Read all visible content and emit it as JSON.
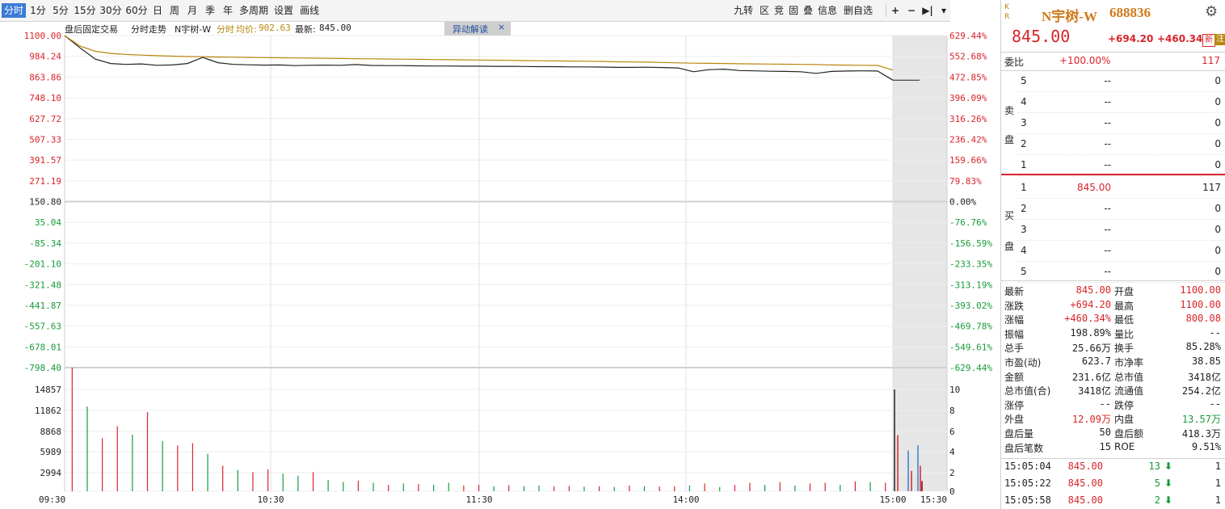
{
  "toolbar": {
    "left": [
      {
        "id": "fenshi",
        "label": "分时",
        "active": true
      },
      {
        "id": "1min",
        "label": "1分"
      },
      {
        "id": "5min",
        "label": "5分"
      },
      {
        "id": "15min",
        "label": "15分"
      },
      {
        "id": "30min",
        "label": "30分"
      },
      {
        "id": "60min",
        "label": "60分"
      },
      {
        "id": "day",
        "label": "日"
      },
      {
        "id": "week",
        "label": "周"
      },
      {
        "id": "month",
        "label": "月"
      },
      {
        "id": "season",
        "label": "季"
      },
      {
        "id": "year",
        "label": "年"
      },
      {
        "id": "multi",
        "label": "多周期"
      },
      {
        "id": "settings",
        "label": "设置"
      },
      {
        "id": "draw",
        "label": "画线"
      }
    ],
    "right": [
      {
        "id": "jiuzhuan",
        "label": "九转"
      },
      {
        "id": "qu",
        "label": "区"
      },
      {
        "id": "jing",
        "label": "竞"
      },
      {
        "id": "gu",
        "label": "固"
      },
      {
        "id": "die",
        "label": "叠"
      },
      {
        "id": "info",
        "label": "信息"
      },
      {
        "id": "del",
        "label": "删自选"
      }
    ],
    "icons": [
      "plus-icon",
      "minus-icon",
      "skip-end-icon",
      "dropdown-icon"
    ]
  },
  "info_bar": {
    "mode": "盘后固定交易",
    "trend": "分时走势",
    "name": "N宇树-W",
    "series_label": "分时",
    "avg_label": "均价:",
    "avg_value": "902.63",
    "latest_label": "最新:",
    "latest_value": "845.00",
    "anomaly_button": "异动解读",
    "close": "×"
  },
  "colors": {
    "up": "#d9242a",
    "down": "#169b3a",
    "price_line": "#222222",
    "avg_line": "#b8860b",
    "accent": "#3a7bd5",
    "shade": "#e6e6e6"
  },
  "chart_data": [
    {
      "type": "line",
      "title": "分时走势",
      "y_left_ticks": [
        "1100.00",
        "984.24",
        "863.86",
        "748.10",
        "627.72",
        "507.33",
        "391.57",
        "271.19",
        "150.80",
        "35.04",
        "-85.34",
        "-201.10",
        "-321.48",
        "-441.87",
        "-557.63",
        "-678.01",
        "-798.40"
      ],
      "y_right_ticks": [
        "629.44%",
        "552.68%",
        "472.85%",
        "396.09%",
        "316.26%",
        "236.42%",
        "159.66%",
        "79.83%",
        "0.00%",
        "-76.76%",
        "-156.59%",
        "-233.35%",
        "-313.19%",
        "-393.02%",
        "-469.78%",
        "-549.61%",
        "-629.44%"
      ],
      "ylim": [
        -798.4,
        1100.0
      ],
      "prev_close": 150.8,
      "x_ticks": [
        "09:30",
        "10:30",
        "11:30",
        "14:00",
        "15:00",
        "15:30"
      ],
      "series": [
        {
          "name": "分时",
          "values": [
            1100,
            1030,
            965,
            940,
            935,
            938,
            930,
            932,
            940,
            975,
            945,
            935,
            933,
            931,
            932,
            928,
            930,
            931,
            930,
            934,
            929,
            928,
            928,
            927,
            926,
            926,
            925,
            925,
            924,
            924,
            923,
            922,
            922,
            921,
            921,
            920,
            918,
            918,
            919,
            917,
            915,
            893,
            905,
            908,
            900,
            898,
            896,
            895,
            893,
            884,
            895,
            897,
            898,
            897,
            845
          ]
        },
        {
          "name": "均价",
          "values": [
            1100,
            1040,
            1010,
            998,
            992,
            988,
            985,
            982,
            980,
            979,
            977,
            976,
            975,
            974,
            973,
            972,
            971,
            970,
            969,
            968,
            967,
            966,
            965,
            964,
            963,
            962,
            961,
            960,
            959,
            958,
            957,
            956,
            955,
            954,
            953,
            952,
            950,
            949,
            948,
            946,
            944,
            942,
            941,
            940,
            939,
            938,
            937,
            936,
            935,
            934,
            932,
            931,
            930,
            929,
            902.63
          ]
        }
      ]
    },
    {
      "type": "bar",
      "title": "成交量",
      "y_left_ticks": [
        "14857",
        "11862",
        "8868",
        "5989",
        "2994",
        "0"
      ],
      "y_right_ticks": [
        "10",
        "8",
        "6",
        "4",
        "2",
        "0"
      ],
      "ylim": [
        0,
        17500
      ],
      "values": [
        17500,
        12000,
        7500,
        9200,
        8000,
        11200,
        7100,
        6500,
        6800,
        5300,
        3600,
        3000,
        2700,
        3100,
        2500,
        2200,
        2700,
        1600,
        1300,
        1500,
        1200,
        900,
        1100,
        1000,
        900,
        1200,
        800,
        900,
        700,
        850,
        700,
        800,
        700,
        750,
        650,
        700,
        600,
        800,
        700,
        650,
        700,
        800,
        1100,
        600,
        900,
        1200,
        900,
        1300,
        800,
        1100,
        1200,
        900,
        1400,
        1300,
        1200
      ],
      "directions": [
        "u",
        "d",
        "u",
        "u",
        "d",
        "u",
        "d",
        "u",
        "u",
        "d",
        "u",
        "d",
        "u",
        "u",
        "d",
        "d",
        "u",
        "d",
        "d",
        "u",
        "d",
        "u",
        "d",
        "u",
        "d",
        "d",
        "u",
        "u",
        "d",
        "u",
        "d",
        "d",
        "u",
        "u",
        "d",
        "u",
        "d",
        "u",
        "d",
        "u",
        "u",
        "d",
        "u",
        "d",
        "u",
        "u",
        "d",
        "u",
        "d",
        "u",
        "u",
        "d",
        "u",
        "d",
        "u"
      ],
      "after_hours_values": [
        10,
        5.5,
        4,
        2,
        4.5,
        2.5,
        1
      ],
      "after_hours_colors": [
        "#222222",
        "#d9242a",
        "#3a7bd5",
        "#d9242a",
        "#3a7bd5",
        "#d9242a",
        "#8b0000"
      ]
    }
  ],
  "quote": {
    "kr": [
      "K",
      "R"
    ],
    "name": "N宇树-W",
    "code": "688836",
    "price": "845.00",
    "change": "+694.20",
    "change_pct": "+460.34%",
    "badges": [
      "新",
      "注"
    ],
    "weibi_label": "委比",
    "weibi_pct": "+100.00%",
    "weibi_value": "117",
    "sell_label": [
      "卖",
      "盘"
    ],
    "buy_label": [
      "买",
      "盘"
    ],
    "sell_rows": [
      {
        "level": "5",
        "price": "--",
        "vol": "0"
      },
      {
        "level": "4",
        "price": "--",
        "vol": "0"
      },
      {
        "level": "3",
        "price": "--",
        "vol": "0"
      },
      {
        "level": "2",
        "price": "--",
        "vol": "0"
      },
      {
        "level": "1",
        "price": "--",
        "vol": "0"
      }
    ],
    "buy_rows": [
      {
        "level": "1",
        "price": "845.00",
        "vol": "117"
      },
      {
        "level": "2",
        "price": "--",
        "vol": "0"
      },
      {
        "level": "3",
        "price": "--",
        "vol": "0"
      },
      {
        "level": "4",
        "price": "--",
        "vol": "0"
      },
      {
        "level": "5",
        "price": "--",
        "vol": "0"
      }
    ],
    "stats": [
      {
        "l1": "最新",
        "v1": "845.00",
        "c1": "red",
        "l2": "开盘",
        "v2": "1100.00",
        "c2": "red"
      },
      {
        "l1": "涨跌",
        "v1": "+694.20",
        "c1": "red",
        "l2": "最高",
        "v2": "1100.00",
        "c2": "red"
      },
      {
        "l1": "涨幅",
        "v1": "+460.34%",
        "c1": "red",
        "l2": "最低",
        "v2": "800.08",
        "c2": "red"
      },
      {
        "l1": "振幅",
        "v1": "198.89%",
        "c1": "dark",
        "l2": "量比",
        "v2": "--",
        "c2": "dark"
      },
      {
        "l1": "总手",
        "v1": "25.66万",
        "c1": "dark",
        "l2": "换手",
        "v2": "85.28%",
        "c2": "dark"
      },
      {
        "l1": "市盈(动)",
        "v1": "623.7",
        "c1": "dark",
        "l2": "市净率",
        "v2": "38.85",
        "c2": "dark"
      },
      {
        "l1": "金额",
        "v1": "231.6亿",
        "c1": "dark",
        "l2": "总市值",
        "v2": "3418亿",
        "c2": "dark"
      },
      {
        "l1": "总市值(合)",
        "v1": "3418亿",
        "c1": "dark",
        "l2": "流通值",
        "v2": "254.2亿",
        "c2": "dark"
      },
      {
        "l1": "涨停",
        "v1": "--",
        "c1": "dark",
        "l2": "跌停",
        "v2": "--",
        "c2": "dark"
      },
      {
        "l1": "外盘",
        "v1": "12.09万",
        "c1": "red",
        "l2": "内盘",
        "v2": "13.57万",
        "c2": "green"
      },
      {
        "l1": "盘后量",
        "v1": "50",
        "c1": "dark",
        "l2": "盘后额",
        "v2": "418.3万",
        "c2": "dark"
      },
      {
        "l1": "盘后笔数",
        "v1": "15",
        "c1": "dark",
        "l2": "ROE",
        "v2": "9.51%",
        "c2": "dark"
      }
    ],
    "ticks": [
      {
        "time": "15:05:04",
        "price": "845.00",
        "vol": "13",
        "count": "1"
      },
      {
        "time": "15:05:22",
        "price": "845.00",
        "vol": "5",
        "count": "1"
      },
      {
        "time": "15:05:58",
        "price": "845.00",
        "vol": "2",
        "count": "1"
      }
    ]
  }
}
